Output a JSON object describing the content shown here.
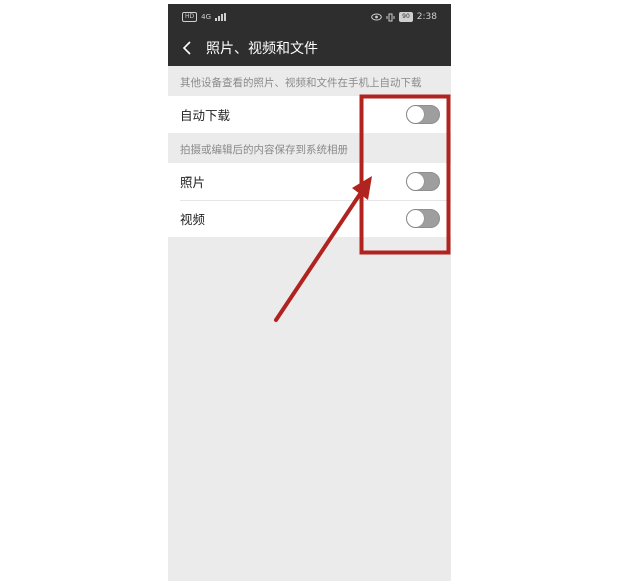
{
  "status_bar": {
    "left_badge": "HD",
    "network": "4G",
    "time": "2:38",
    "battery": "90"
  },
  "nav": {
    "title": "照片、视频和文件",
    "back_icon": "chevron-left-icon"
  },
  "sections": [
    {
      "header": "其他设备查看的照片、视频和文件在手机上自动下载",
      "items": [
        {
          "label": "自动下载",
          "enabled": false
        }
      ]
    },
    {
      "header": "拍摄或编辑后的内容保存到系统相册",
      "items": [
        {
          "label": "照片",
          "enabled": false
        },
        {
          "label": "视频",
          "enabled": false
        }
      ]
    }
  ],
  "colors": {
    "nav_bg": "#2e2e2e",
    "page_bg": "#ebebeb",
    "toggle_off": "#9e9e9e",
    "annotation": "#b0231f"
  }
}
